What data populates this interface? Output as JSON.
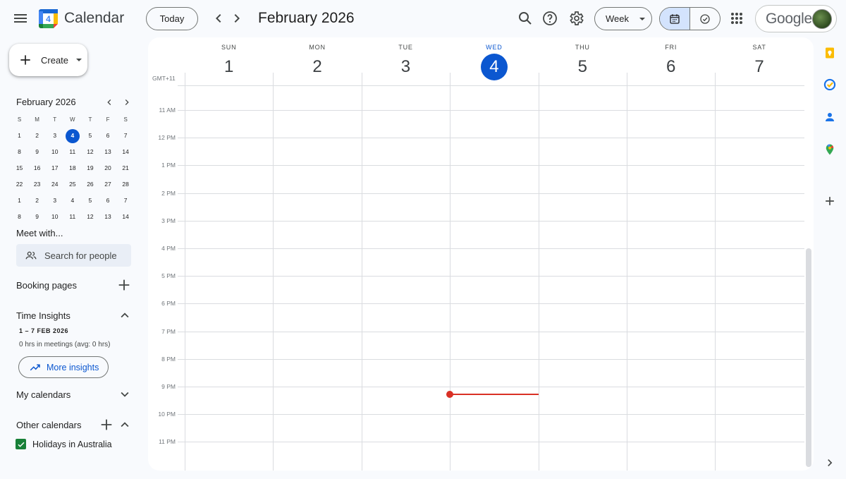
{
  "header": {
    "app_title": "Calendar",
    "logo_day": "4",
    "today_label": "Today",
    "current_period": "February 2026",
    "view_label": "Week",
    "account_word": "Google"
  },
  "sidebar": {
    "create_label": "Create",
    "mini_calendar": {
      "title": "February 2026",
      "weekdays": [
        "S",
        "M",
        "T",
        "W",
        "T",
        "F",
        "S"
      ],
      "weeks": [
        [
          "1",
          "2",
          "3",
          "4",
          "5",
          "6",
          "7"
        ],
        [
          "8",
          "9",
          "10",
          "11",
          "12",
          "13",
          "14"
        ],
        [
          "15",
          "16",
          "17",
          "18",
          "19",
          "20",
          "21"
        ],
        [
          "22",
          "23",
          "24",
          "25",
          "26",
          "27",
          "28"
        ],
        [
          "1",
          "2",
          "3",
          "4",
          "5",
          "6",
          "7"
        ],
        [
          "8",
          "9",
          "10",
          "11",
          "12",
          "13",
          "14"
        ]
      ],
      "today": "4"
    },
    "meet_with": {
      "title": "Meet with...",
      "search_placeholder": "Search for people"
    },
    "booking_pages": "Booking pages",
    "time_insights": {
      "title": "Time Insights",
      "range": "1 – 7 FEB 2026",
      "summary": "0 hrs in meetings (avg: 0 hrs)",
      "button": "More insights"
    },
    "my_calendars": "My calendars",
    "other_calendars": {
      "title": "Other calendars",
      "items": [
        {
          "label": "Holidays in Australia",
          "checked": true,
          "color": "#188038"
        }
      ]
    }
  },
  "week_view": {
    "timezone": "GMT+11",
    "days": [
      {
        "name": "SUN",
        "num": "1"
      },
      {
        "name": "MON",
        "num": "2"
      },
      {
        "name": "TUE",
        "num": "3"
      },
      {
        "name": "WED",
        "num": "4",
        "today": true
      },
      {
        "name": "THU",
        "num": "5"
      },
      {
        "name": "FRI",
        "num": "6"
      },
      {
        "name": "SAT",
        "num": "7"
      }
    ],
    "hours": [
      "11 AM",
      "12 PM",
      "1 PM",
      "2 PM",
      "3 PM",
      "4 PM",
      "5 PM",
      "6 PM",
      "7 PM",
      "8 PM",
      "9 PM",
      "10 PM",
      "11 PM"
    ],
    "current_time_day": "WED"
  },
  "colors": {
    "accent": "#0b57d0",
    "now_indicator": "#d93025",
    "selected_toggle": "#d3e3fd"
  }
}
